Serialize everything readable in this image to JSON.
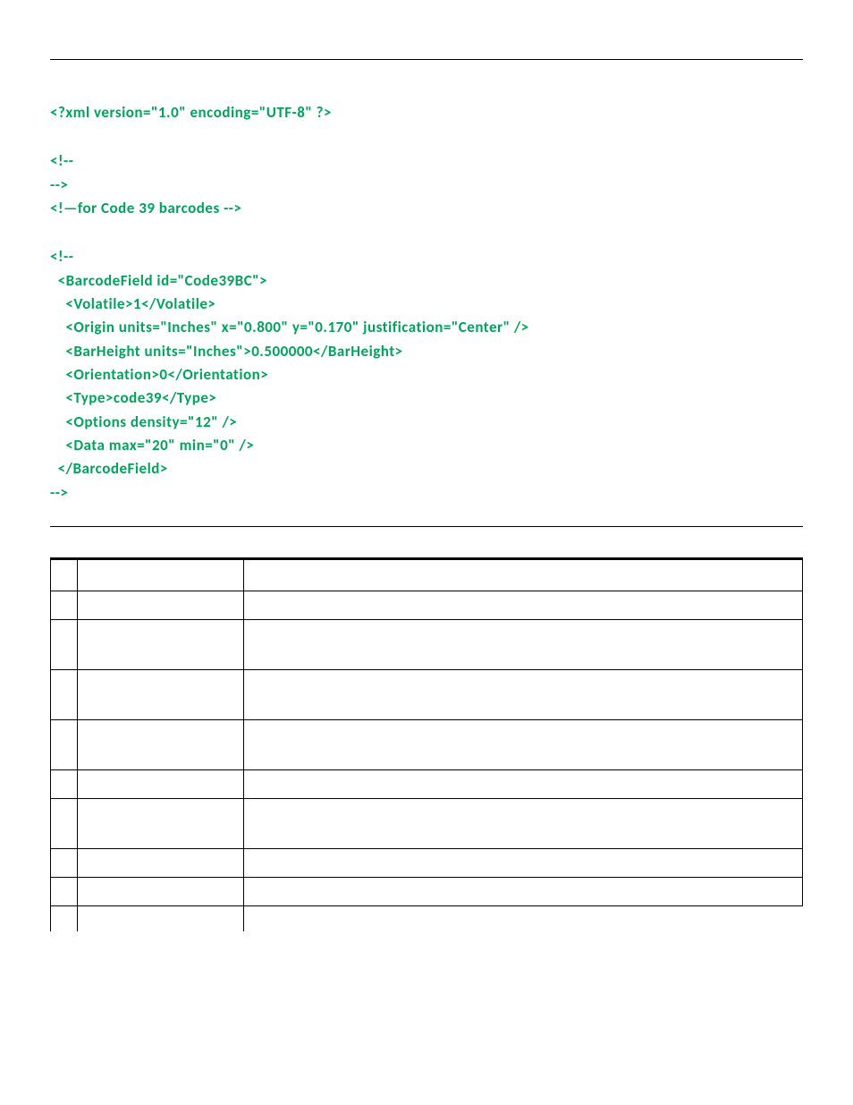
{
  "code": {
    "l1": "<?xml version=\"1.0\" encoding=\"UTF-8\" ?>",
    "l2": "<!--",
    "l3": "-->",
    "l4": "<!—for Code 39 barcodes -->",
    "l5": "<!--",
    "l6": "  <BarcodeField id=\"Code39BC\">",
    "l7": "    <Volatile>1</Volatile>",
    "l8": "    <Origin units=\"Inches\" x=\"0.800\" y=\"0.170\" justification=\"Center\" />",
    "l9": "    <BarHeight units=\"Inches\">0.500000</BarHeight>",
    "l10": "    <Orientation>0</Orientation>",
    "l11": "    <Type>code39</Type>",
    "l12": "    <Options density=\"12\" />",
    "l13": "    <Data max=\"20\" min=\"0\" />",
    "l14": "  </BarcodeField>",
    "l15": "-->"
  },
  "table": {
    "head": {
      "a": "",
      "b": "",
      "c": ""
    },
    "rows": [
      {
        "a": "",
        "b": "",
        "c": ""
      },
      {
        "a": "",
        "b": "",
        "c": ""
      },
      {
        "a": "",
        "b": "",
        "c": ""
      },
      {
        "a": "",
        "b": "",
        "c": ""
      },
      {
        "a": "",
        "b": "",
        "c": ""
      },
      {
        "a": "",
        "b": "",
        "c": ""
      },
      {
        "a": "",
        "b": "",
        "c": ""
      },
      {
        "a": "",
        "b": "",
        "c": ""
      },
      {
        "a": "",
        "b": "",
        "c": ""
      }
    ]
  },
  "colors": {
    "code_green": "#00a45a"
  }
}
